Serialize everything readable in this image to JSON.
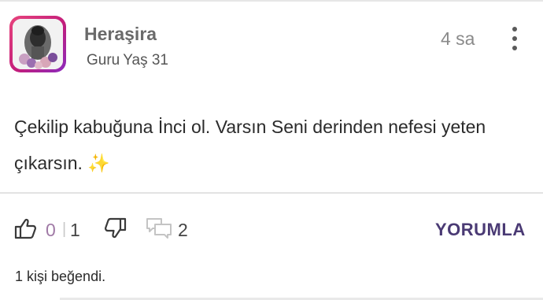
{
  "post": {
    "author": {
      "username": "Heraşira",
      "rank": "Guru",
      "age": "Yaş 31"
    },
    "time_ago": "4 sa",
    "text": "Çekilip kabuğuna İnci ol. Varsın Seni derinden nefesi yeten çıkarsın. ✨"
  },
  "actions": {
    "like_count": "0",
    "separator": "|",
    "dislike_count": "1",
    "comment_count": "2",
    "reply_label": "YORUMLA"
  },
  "likes_summary": "1 kişi beğendi.",
  "icons": {
    "like": "thumbs-up-icon",
    "dislike": "thumbs-down-icon",
    "comment": "speech-bubbles-icon",
    "menu": "more-vertical-icon"
  },
  "colors": {
    "avatar_ring": "#c21d7b",
    "reply_accent": "#4a3a74",
    "like_count": "#a07aa6"
  }
}
